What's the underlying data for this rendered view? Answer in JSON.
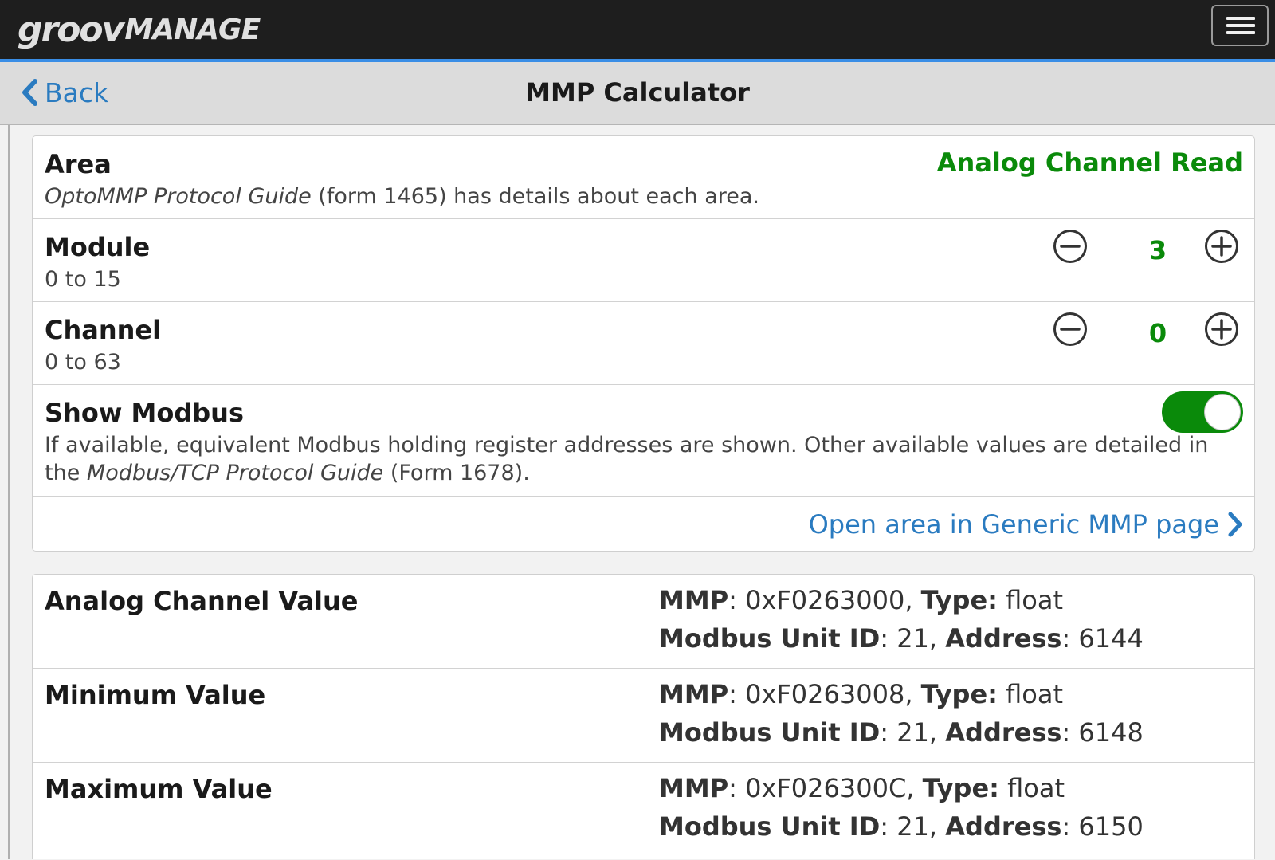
{
  "header": {
    "logo_part1": "groov",
    "logo_part2": "MANAGE",
    "menu_icon": "hamburger-icon"
  },
  "nav": {
    "back_label": "Back",
    "back_icon": "chevron-left-icon",
    "title": "MMP Calculator"
  },
  "config": {
    "area": {
      "label": "Area",
      "value": "Analog Channel Read",
      "desc_italic": "OptoMMP Protocol Guide",
      "desc_rest": " (form 1465) has details about each area."
    },
    "module": {
      "label": "Module",
      "range": "0 to 15",
      "value": "3"
    },
    "channel": {
      "label": "Channel",
      "range": "0 to 63",
      "value": "0"
    },
    "show_modbus": {
      "label": "Show Modbus",
      "enabled": true,
      "desc_part1": "If available, equivalent Modbus holding register addresses are shown. Other available values are detailed in the ",
      "desc_italic": "Modbus/TCP Protocol Guide",
      "desc_part2": " (Form 1678)."
    },
    "open_link": {
      "label": "Open area in Generic MMP page",
      "icon": "chevron-right-icon"
    }
  },
  "results_labels": {
    "mmp": "MMP",
    "type": "Type:",
    "unit_id": "Modbus Unit ID",
    "address": "Address"
  },
  "results": [
    {
      "name": "Analog Channel Value",
      "mmp": "0xF0263000",
      "type": "float",
      "unit_id": "21",
      "address": "6144"
    },
    {
      "name": "Minimum Value",
      "mmp": "0xF0263008",
      "type": "float",
      "unit_id": "21",
      "address": "6148"
    },
    {
      "name": "Maximum Value",
      "mmp": "0xF026300C",
      "type": "float",
      "unit_id": "21",
      "address": "6150"
    }
  ],
  "colors": {
    "accent_blue": "#2a7bc0",
    "value_green": "#0a8a0a",
    "topbar": "#1e1e1e",
    "topbar_border": "#3a8ee6"
  }
}
